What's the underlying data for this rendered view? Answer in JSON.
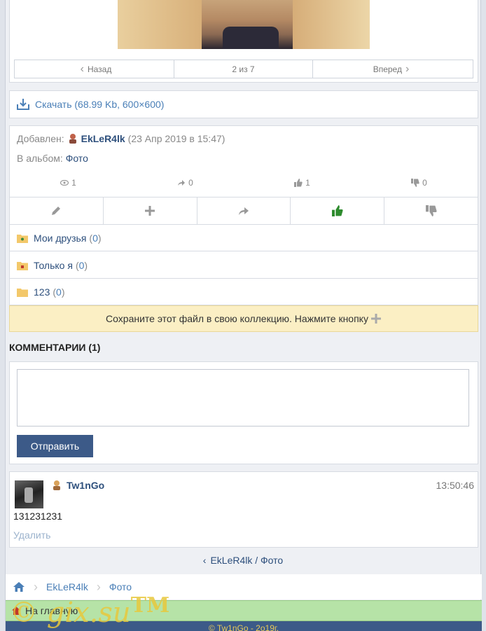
{
  "pager": {
    "prev": "Назад",
    "position": "2 из 7",
    "next": "Вперед"
  },
  "download": {
    "label": "Скачать (68.99 Kb, 600×600)"
  },
  "info": {
    "added_label": "Добавлен:",
    "author": "EkLeR4lk",
    "date": "(23 Апр 2019 в 15:47)",
    "album_label": "В альбом:",
    "album_name": "Фото"
  },
  "stats": {
    "views": "1",
    "shares": "0",
    "likes": "1",
    "dislikes": "0"
  },
  "folders": [
    {
      "name": "Мои друзья",
      "count_open": "(",
      "count": "0",
      "count_close": ")"
    },
    {
      "name": "Только я",
      "count_open": "(",
      "count": "0",
      "count_close": ")"
    },
    {
      "name": "123",
      "count_open": "(",
      "count": "0",
      "count_close": ")"
    }
  ],
  "notice": "Сохраните этот файл в свою коллекцию. Нажмите кнопку",
  "comments": {
    "title": "КОММЕНТАРИИ (1)",
    "submit": "Отправить",
    "items": [
      {
        "user": "Tw1nGo",
        "time": "13:50:46",
        "text": "131231231",
        "delete": "Удалить"
      }
    ]
  },
  "back_link": "EkLeR4lk / Фото",
  "breadcrumbs": [
    "EkLeR4lk",
    "Фото"
  ],
  "home_link": "На главную",
  "footer": "© Tw1nGo - 2o19г.",
  "watermark": {
    "text": "© gix.su",
    "mark": "TM"
  },
  "colors": {
    "accent": "#3c5a88",
    "link": "#4a7fb7",
    "like": "#2e8b2e",
    "notice": "#fbefc4",
    "home_bar": "#b6e3a7"
  }
}
